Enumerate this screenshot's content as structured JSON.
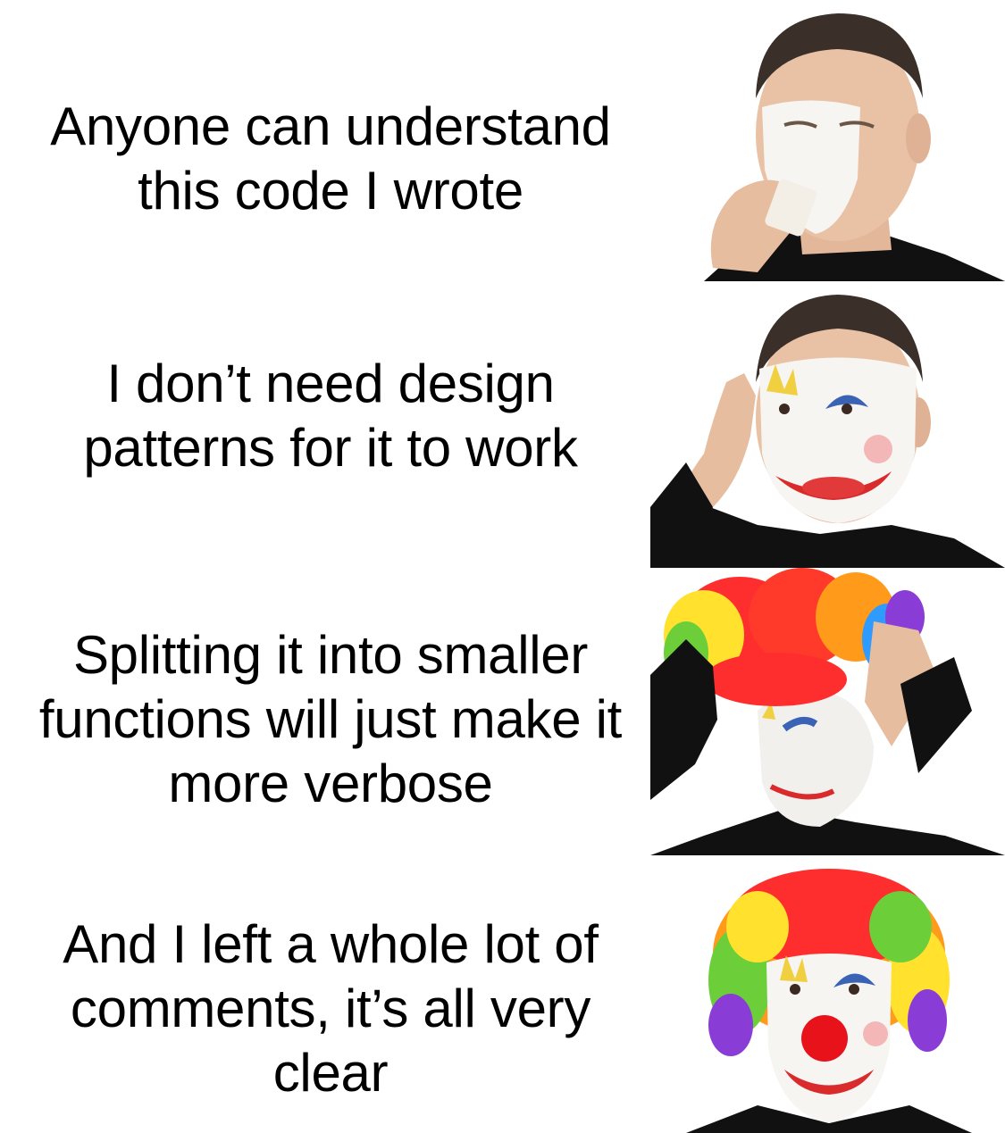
{
  "meme": {
    "template": "clown-applying-makeup",
    "panels": [
      {
        "caption_lines": [
          "Anyone can understand",
          "this code I wrote"
        ],
        "stage": "white base makeup"
      },
      {
        "caption_lines": [
          "I don’t need design",
          "patterns for it to work"
        ],
        "stage": "eye paint and red lips"
      },
      {
        "caption_lines": [
          "Splitting it into smaller",
          "functions will just make it",
          "more verbose"
        ],
        "stage": "putting on rainbow wig"
      },
      {
        "caption_lines": [
          "And I left a whole lot of",
          "comments, it’s all very",
          "clear"
        ],
        "stage": "full clown with red nose"
      }
    ]
  },
  "colors": {
    "background": "#ffffff",
    "text": "#000000",
    "skin": "#e9c2a6",
    "hair": "#3a2f29",
    "face_paint": "#f7f5f2",
    "shirt": "#111111",
    "lip_red": "#d92b2b",
    "eye_blue": "#3a63b5",
    "eye_yellow": "#f0d040",
    "nose_red": "#e8131a",
    "wig": [
      "#ff2e2e",
      "#ff9a1a",
      "#ffe12e",
      "#6ccf3a",
      "#2f9bff",
      "#8a3cd6"
    ]
  }
}
